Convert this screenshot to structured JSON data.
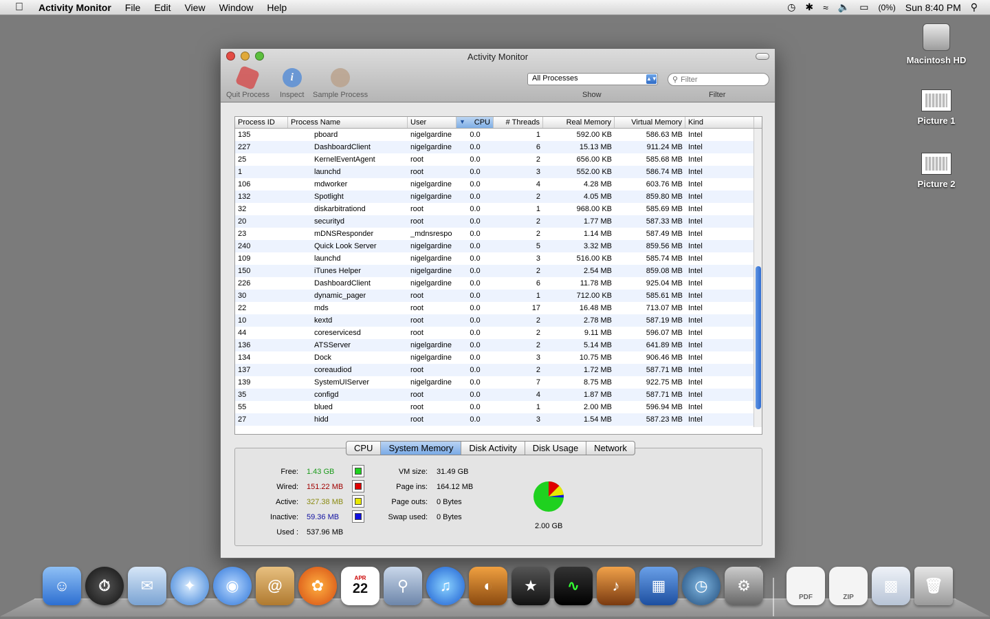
{
  "menubar": {
    "app_name": "Activity Monitor",
    "menus": [
      "File",
      "Edit",
      "View",
      "Window",
      "Help"
    ],
    "battery": "(0%)",
    "clock": "Sun 8:40 PM"
  },
  "desktop": {
    "icons": [
      {
        "label": "Macintosh HD"
      },
      {
        "label": "Picture 1"
      },
      {
        "label": "Picture 2"
      }
    ]
  },
  "window": {
    "title": "Activity Monitor",
    "toolbar": {
      "quit_label": "Quit Process",
      "inspect_label": "Inspect",
      "sample_label": "Sample Process",
      "show_value": "All Processes",
      "show_label": "Show",
      "filter_placeholder": "Filter",
      "filter_label": "Filter"
    },
    "table": {
      "columns": [
        "Process ID",
        "Process Name",
        "User",
        "CPU",
        "# Threads",
        "Real Memory",
        "Virtual Memory",
        "Kind"
      ],
      "rows": [
        [
          "135",
          "pboard",
          "nigelgardine",
          "0.0",
          "1",
          "592.00 KB",
          "586.63 MB",
          "Intel"
        ],
        [
          "227",
          "DashboardClient",
          "nigelgardine",
          "0.0",
          "6",
          "15.13 MB",
          "911.24 MB",
          "Intel"
        ],
        [
          "25",
          "KernelEventAgent",
          "root",
          "0.0",
          "2",
          "656.00 KB",
          "585.68 MB",
          "Intel"
        ],
        [
          "1",
          "launchd",
          "root",
          "0.0",
          "3",
          "552.00 KB",
          "586.74 MB",
          "Intel"
        ],
        [
          "106",
          "mdworker",
          "nigelgardine",
          "0.0",
          "4",
          "4.28 MB",
          "603.76 MB",
          "Intel"
        ],
        [
          "132",
          "Spotlight",
          "nigelgardine",
          "0.0",
          "2",
          "4.05 MB",
          "859.80 MB",
          "Intel"
        ],
        [
          "32",
          "diskarbitrationd",
          "root",
          "0.0",
          "1",
          "968.00 KB",
          "585.69 MB",
          "Intel"
        ],
        [
          "20",
          "securityd",
          "root",
          "0.0",
          "2",
          "1.77 MB",
          "587.33 MB",
          "Intel"
        ],
        [
          "23",
          "mDNSResponder",
          "_mdnsrespo",
          "0.0",
          "2",
          "1.14 MB",
          "587.49 MB",
          "Intel"
        ],
        [
          "240",
          "Quick Look Server",
          "nigelgardine",
          "0.0",
          "5",
          "3.32 MB",
          "859.56 MB",
          "Intel"
        ],
        [
          "109",
          "launchd",
          "nigelgardine",
          "0.0",
          "3",
          "516.00 KB",
          "585.74 MB",
          "Intel"
        ],
        [
          "150",
          "iTunes Helper",
          "nigelgardine",
          "0.0",
          "2",
          "2.54 MB",
          "859.08 MB",
          "Intel"
        ],
        [
          "226",
          "DashboardClient",
          "nigelgardine",
          "0.0",
          "6",
          "11.78 MB",
          "925.04 MB",
          "Intel"
        ],
        [
          "30",
          "dynamic_pager",
          "root",
          "0.0",
          "1",
          "712.00 KB",
          "585.61 MB",
          "Intel"
        ],
        [
          "22",
          "mds",
          "root",
          "0.0",
          "17",
          "16.48 MB",
          "713.07 MB",
          "Intel"
        ],
        [
          "10",
          "kextd",
          "root",
          "0.0",
          "2",
          "2.78 MB",
          "587.19 MB",
          "Intel"
        ],
        [
          "44",
          "coreservicesd",
          "root",
          "0.0",
          "2",
          "9.11 MB",
          "596.07 MB",
          "Intel"
        ],
        [
          "136",
          "ATSServer",
          "nigelgardine",
          "0.0",
          "2",
          "5.14 MB",
          "641.89 MB",
          "Intel"
        ],
        [
          "134",
          "Dock",
          "nigelgardine",
          "0.0",
          "3",
          "10.75 MB",
          "906.46 MB",
          "Intel"
        ],
        [
          "137",
          "coreaudiod",
          "root",
          "0.0",
          "2",
          "1.72 MB",
          "587.71 MB",
          "Intel"
        ],
        [
          "139",
          "SystemUIServer",
          "nigelgardine",
          "0.0",
          "7",
          "8.75 MB",
          "922.75 MB",
          "Intel"
        ],
        [
          "35",
          "configd",
          "root",
          "0.0",
          "4",
          "1.87 MB",
          "587.71 MB",
          "Intel"
        ],
        [
          "55",
          "blued",
          "root",
          "0.0",
          "1",
          "2.00 MB",
          "596.94 MB",
          "Intel"
        ],
        [
          "27",
          "hidd",
          "root",
          "0.0",
          "3",
          "1.54 MB",
          "587.23 MB",
          "Intel"
        ]
      ]
    },
    "tabs": [
      "CPU",
      "System Memory",
      "Disk Activity",
      "Disk Usage",
      "Network"
    ],
    "active_tab": "System Memory",
    "memory": {
      "free_label": "Free:",
      "free_value": "1.43 GB",
      "wired_label": "Wired:",
      "wired_value": "151.22 MB",
      "active_label": "Active:",
      "active_value": "327.38 MB",
      "inactive_label": "Inactive:",
      "inactive_value": "59.36 MB",
      "used_label": "Used :",
      "used_value": "537.96 MB",
      "vmsize_label": "VM size:",
      "vmsize_value": "31.49 GB",
      "pageins_label": "Page ins:",
      "pageins_value": "164.12 MB",
      "pageouts_label": "Page outs:",
      "pageouts_value": "0 Bytes",
      "swap_label": "Swap used:",
      "swap_value": "0 Bytes",
      "total_label": "2.00 GB",
      "colors": {
        "free": "#1fd11f",
        "wired": "#e00000",
        "active": "#e8e800",
        "inactive": "#1010e0"
      }
    }
  },
  "dock": {
    "items": [
      "Finder",
      "Dashboard",
      "Mail",
      "Safari",
      "iChat",
      "Address Book",
      "Firefox",
      "iCal",
      "Preview",
      "iTunes",
      "iPhoto",
      "iMovie",
      "Activity Monitor",
      "GarageBand",
      "Spaces",
      "Time Machine",
      "System Preferences",
      "PDF",
      "ZIP",
      "Firefox Window",
      "Trash"
    ],
    "pdf_label": "PDF",
    "zip_label": "ZIP",
    "ical_month": "APR",
    "ical_day": "22"
  }
}
